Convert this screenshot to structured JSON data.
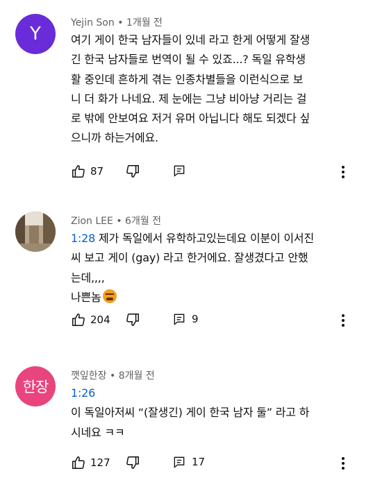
{
  "comments": [
    {
      "avatar_letter": "Y",
      "avatar_color": "#6a2bd8",
      "author": "Yejin Son",
      "time": "1개월 전",
      "body_lines": [
        "여기 게이 한국 남자들이 있네 라고 한게 어떻게 잘생",
        "긴 한국 남자들로 번역이 될 수 있죠...? 독일 유학생",
        "활 중인데 흔하게 겪는 인종차별들을 이런식으로 보",
        "니 더 화가 나네요. 제 눈에는 그냥 비아냥 거리는 걸",
        "로 밖에 안보여요 저거 유머 아닙니다 해도 되겠다 싶",
        "으니까 하는거에요."
      ],
      "likes": "87",
      "replies": ""
    },
    {
      "avatar_kind": "photo",
      "author": "Zion LEE",
      "time": "6개월 전",
      "timestamp_link": "1:28",
      "body_first": "제가 독일에서 유학하고있는데요 이분이 이서진",
      "body_lines": [
        "씨 보고 게이 (gay) 라고 한거에요. 잘생겼다고 안했",
        "는데,,,,",
        "나쁜놈"
      ],
      "emoji": "angry-face-emoji",
      "likes": "204",
      "replies": "9"
    },
    {
      "avatar_text": "한장",
      "avatar_color": "#e8457f",
      "author": "깻잎한장",
      "time": "8개월 전",
      "timestamp_link": "1:26",
      "body_lines": [
        "이 독일아저씨 “(잘생긴) 게이 한국 남자 둘” 라고 하",
        "시네요 ㅋㅋ"
      ],
      "likes": "127",
      "replies": "17"
    }
  ],
  "separator": "•"
}
